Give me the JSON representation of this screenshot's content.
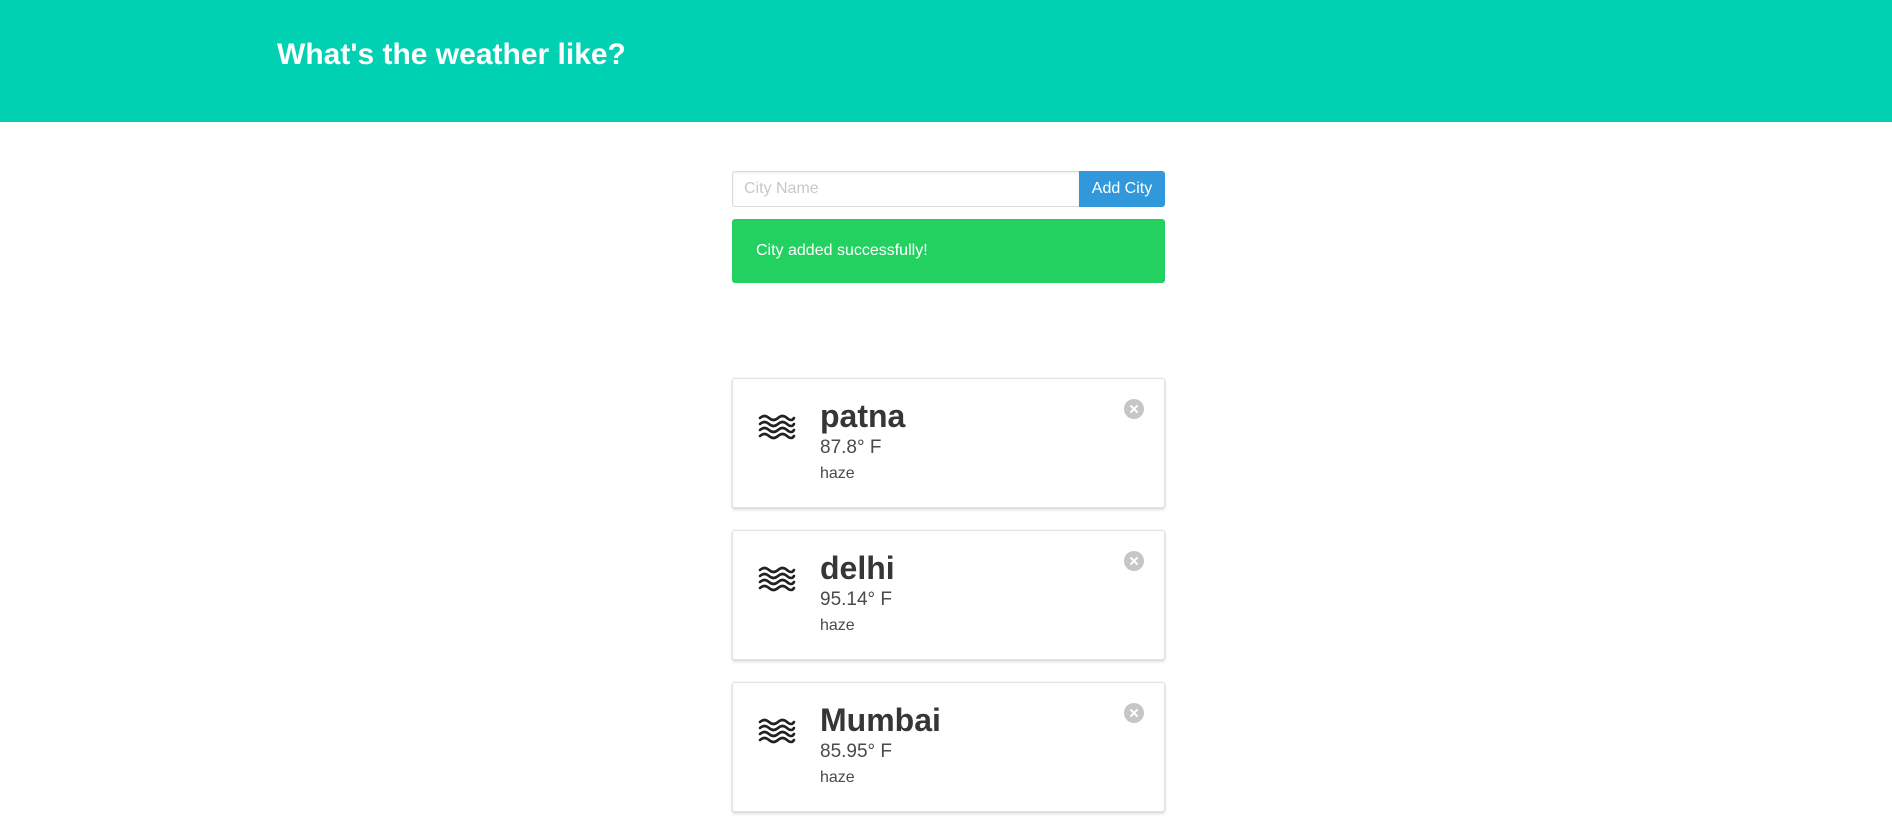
{
  "header": {
    "title": "What's the weather like?"
  },
  "search": {
    "placeholder": "City Name",
    "value": "",
    "button_label": "Add City"
  },
  "notification": {
    "message": "City added successfully!",
    "color": "#23d160"
  },
  "colors": {
    "hero": "#00d1b2",
    "button": "#3298dc"
  },
  "cities": [
    {
      "name": "patna",
      "temperature": "87.8° F",
      "description": "haze",
      "icon": "haze-icon"
    },
    {
      "name": "delhi",
      "temperature": "95.14° F",
      "description": "haze",
      "icon": "haze-icon"
    },
    {
      "name": "Mumbai",
      "temperature": "85.95° F",
      "description": "haze",
      "icon": "haze-icon"
    }
  ]
}
